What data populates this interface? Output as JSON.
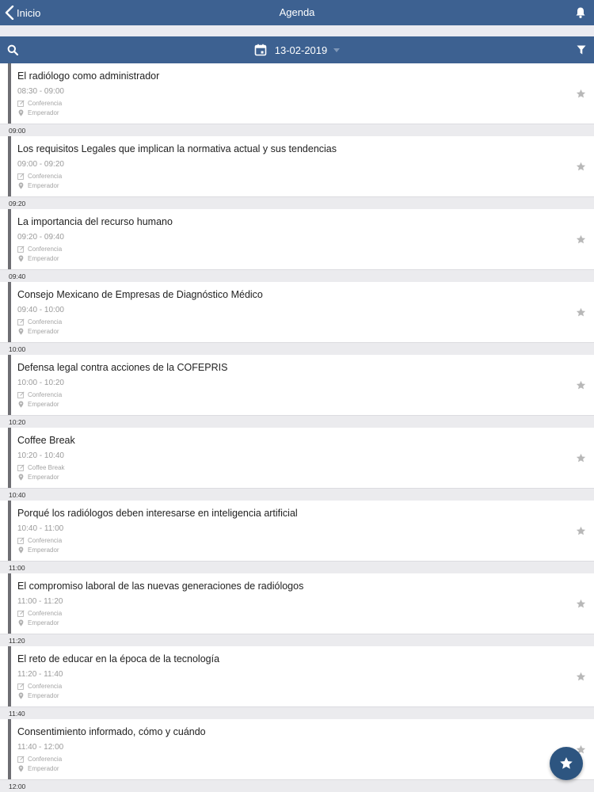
{
  "navbar": {
    "back_label": "Inicio",
    "title": "Agenda"
  },
  "toolbar": {
    "date": "13-02-2019"
  },
  "colors": {
    "header": "#3d6191",
    "fab": "#2d5580",
    "session_bar": "#6e6e73"
  },
  "sessions": [
    {
      "title": "El radiólogo como administrador",
      "time": "08:30 - 09:00",
      "type": "Conferencia",
      "room": "Emperador",
      "separator": "09:00"
    },
    {
      "title": "Los requisitos Legales que implican la normativa actual y sus tendencias",
      "time": "09:00 - 09:20",
      "type": "Conferencia",
      "room": "Emperador",
      "separator": "09:20"
    },
    {
      "title": "La importancia del recurso humano",
      "time": "09:20 - 09:40",
      "type": "Conferencia",
      "room": "Emperador",
      "separator": "09:40"
    },
    {
      "title": "Consejo Mexicano de Empresas de Diagnóstico Médico",
      "time": "09:40 - 10:00",
      "type": "Conferencia",
      "room": "Emperador",
      "separator": "10:00"
    },
    {
      "title": "Defensa legal contra acciones de la COFEPRIS",
      "time": "10:00 - 10:20",
      "type": "Conferencia",
      "room": "Emperador",
      "separator": "10:20"
    },
    {
      "title": "Coffee Break",
      "time": "10:20 - 10:40",
      "type": "Coffee Break",
      "room": "Emperador",
      "separator": "10:40"
    },
    {
      "title": "Porqué los radiólogos deben interesarse en inteligencia artificial",
      "time": "10:40 - 11:00",
      "type": "Conferencia",
      "room": "Emperador",
      "separator": "11:00"
    },
    {
      "title": "El compromiso laboral de las nuevas generaciones de radiólogos",
      "time": "11:00 - 11:20",
      "type": "Conferencia",
      "room": "Emperador",
      "separator": "11:20"
    },
    {
      "title": "El reto de educar en la época de la tecnología",
      "time": "11:20 - 11:40",
      "type": "Conferencia",
      "room": "Emperador",
      "separator": "11:40"
    },
    {
      "title": "Consentimiento informado, cómo y cuándo",
      "time": "11:40 - 12:00",
      "type": "Conferencia",
      "room": "Emperador",
      "separator": "12:00"
    }
  ],
  "icons": {
    "back": "chevron-left-icon",
    "bell": "bell-icon",
    "search": "search-icon",
    "calendar": "calendar-icon",
    "filter": "filter-icon",
    "star": "star-icon",
    "type": "edit-icon",
    "room": "location-pin-icon"
  }
}
